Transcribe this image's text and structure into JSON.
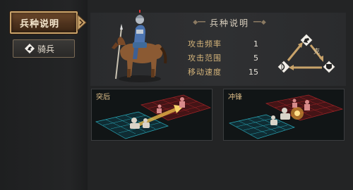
{
  "sidebar": {
    "active_tab_label": "兵种说明",
    "unit_button_label": "骑兵"
  },
  "panel": {
    "title": "兵种说明",
    "stats": [
      {
        "label": "攻击频率",
        "value": "1"
      },
      {
        "label": "攻击范围",
        "value": "5"
      },
      {
        "label": "移动速度",
        "value": "15"
      }
    ],
    "counter_text": "克"
  },
  "previews": [
    {
      "label": "突后"
    },
    {
      "label": "冲锋"
    }
  ],
  "colors": {
    "accent_gold": "#c9a36a",
    "enemy_red": "#b3262a",
    "ally_cyan": "#2aa8b8"
  },
  "icons": [
    "chevron-right-icon",
    "cavalry-badge-icon",
    "horse-rider-icon",
    "spear-icon",
    "bow-icon",
    "shield-icon"
  ]
}
